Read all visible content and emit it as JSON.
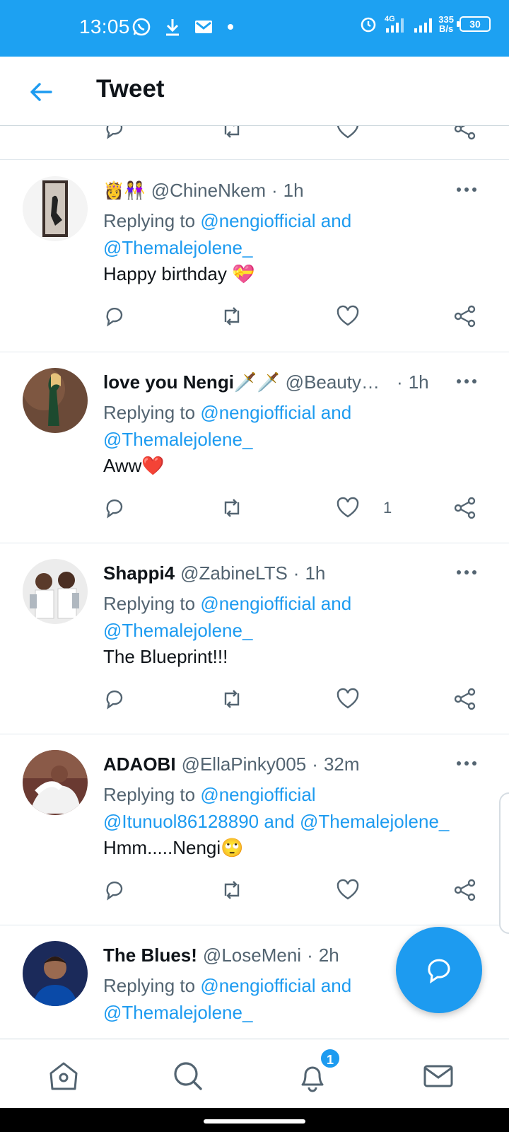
{
  "status_bar": {
    "time": "13:05",
    "network": "4G",
    "speed_value": "335",
    "speed_unit": "B/s",
    "battery": "30",
    "bg_color": "#1da1f2"
  },
  "header": {
    "title": "Tweet",
    "back_icon": "arrow-left-icon"
  },
  "replies": [
    {
      "emoji_prefix": "👸👭",
      "name": "",
      "handle": "@ChineNkem",
      "sep": "·",
      "time": "1h",
      "replying_label": "Replying to",
      "mention_line1": "@nengiofficial and",
      "mention_line2": "@Themalejolene_",
      "text": "Happy birthday 💝",
      "like_count": ""
    },
    {
      "emoji_prefix": "",
      "name": "love you Nengi🗡️🗡️",
      "handle": "@Beauty…",
      "sep": "·",
      "time": "1h",
      "replying_label": "Replying to",
      "mention_line1": "@nengiofficial and",
      "mention_line2": "@Themalejolene_",
      "text": "Aww❤️",
      "like_count": "1"
    },
    {
      "emoji_prefix": "",
      "name": "Shappi4",
      "handle": "@ZabineLTS",
      "sep": "·",
      "time": "1h",
      "replying_label": "Replying to",
      "mention_line1": "@nengiofficial and",
      "mention_line2": "@Themalejolene_",
      "text": "The Blueprint!!!",
      "like_count": ""
    },
    {
      "emoji_prefix": "",
      "name": "ADAOBI",
      "handle": "@EllaPinky005",
      "sep": "·",
      "time": "32m",
      "replying_label": "Replying to",
      "mention_line1": "@nengiofficial",
      "mention_line2": "@Itunuol86128890 and @Themalejolene_",
      "text": "Hmm.....Nengi🙄",
      "like_count": ""
    },
    {
      "emoji_prefix": "",
      "name": "The Blues!",
      "handle": "@LoseMeni",
      "sep": "·",
      "time": "2h",
      "replying_label": "Replying to",
      "mention_line1": "@nengiofficial and",
      "mention_line2": "@Themalejolene_",
      "text": "",
      "like_count": ""
    }
  ],
  "fab": {
    "icon": "compose-reply-icon"
  },
  "bottom_nav": {
    "items": [
      "home-icon",
      "search-icon",
      "notifications-icon",
      "messages-icon"
    ],
    "notification_badge": "1"
  },
  "colors": {
    "accent": "#1d9bf0",
    "secondary_text": "#536471",
    "primary_text": "#0f1419"
  }
}
